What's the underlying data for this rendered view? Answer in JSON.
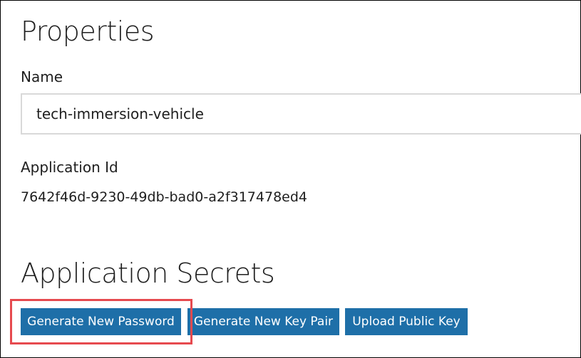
{
  "properties": {
    "title": "Properties",
    "name_label": "Name",
    "name_value": "tech-immersion-vehicle",
    "app_id_label": "Application Id",
    "app_id_value": "7642f46d-9230-49db-bad0-a2f317478ed4"
  },
  "secrets": {
    "title": "Application Secrets",
    "buttons": [
      {
        "label": "Generate New Password"
      },
      {
        "label": "Generate New Key Pair"
      },
      {
        "label": "Upload Public Key"
      }
    ]
  },
  "colors": {
    "button_bg": "#1e6fa8",
    "button_text": "#ffffff",
    "highlight": "#e64a4f",
    "text": "#1e1e1e"
  }
}
